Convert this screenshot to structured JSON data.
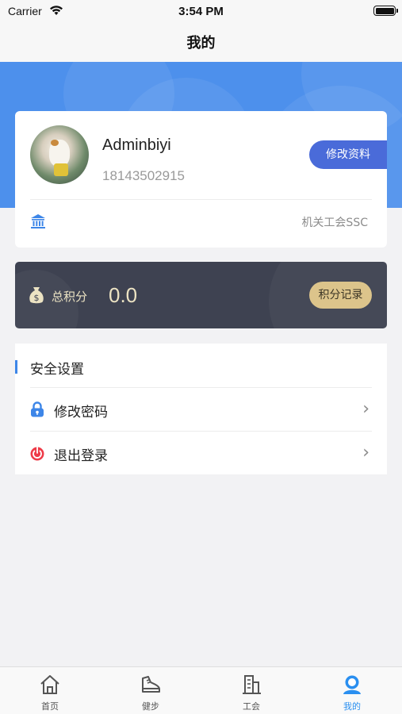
{
  "status_bar": {
    "carrier": "Carrier",
    "time": "3:54 PM"
  },
  "nav": {
    "title": "我的"
  },
  "profile": {
    "username": "Adminbiyi",
    "phone": "18143502915",
    "edit_label": "修改资料",
    "org_name": "机关工会SSC"
  },
  "points": {
    "label": "总积分",
    "value": "0.0",
    "history_label": "积分记录"
  },
  "security": {
    "title": "安全设置",
    "items": [
      {
        "label": "修改密码",
        "icon": "lock-icon"
      },
      {
        "label": "退出登录",
        "icon": "power-icon"
      }
    ]
  },
  "tabs": [
    {
      "label": "首页",
      "icon": "home-icon",
      "active": false
    },
    {
      "label": "健步",
      "icon": "shoe-icon",
      "active": false
    },
    {
      "label": "工会",
      "icon": "building-icon",
      "active": false
    },
    {
      "label": "我的",
      "icon": "user-icon",
      "active": true
    }
  ],
  "colors": {
    "accent": "#2a8ff0",
    "hero_blue": "#4d90ec",
    "edit_button": "#4a6bd9",
    "points_card": "#3e4251",
    "points_gold": "#dcc48b"
  }
}
